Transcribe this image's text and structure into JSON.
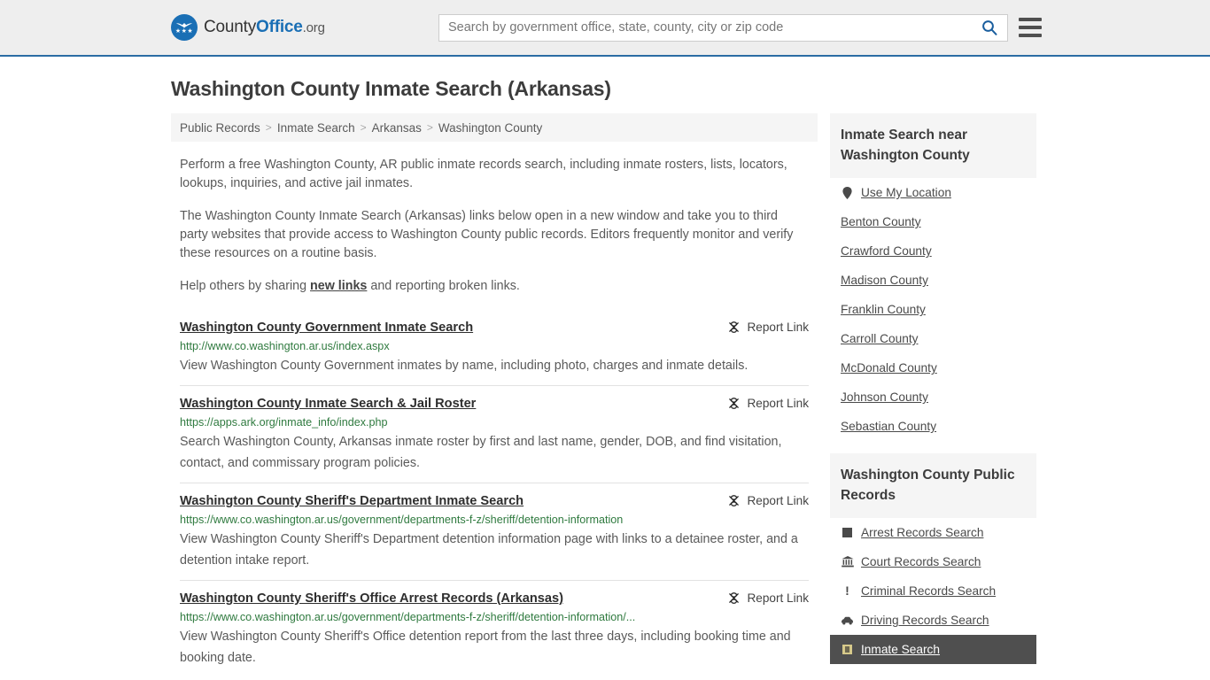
{
  "header": {
    "logo": {
      "part1": "County",
      "part2": "Office",
      "part3": ".org",
      "icon": "eagle-shield-icon"
    },
    "search": {
      "placeholder": "Search by government office, state, county, city or zip code",
      "value": "",
      "icon": "search-icon"
    },
    "menu": {
      "icon": "hamburger-menu-icon",
      "label": "Menu"
    }
  },
  "page": {
    "title": "Washington County Inmate Search (Arkansas)"
  },
  "breadcrumb": {
    "separator": ">",
    "items": [
      {
        "label": "Public Records"
      },
      {
        "label": "Inmate Search"
      },
      {
        "label": "Arkansas"
      },
      {
        "label": "Washington County"
      }
    ]
  },
  "intro": {
    "p1": "Perform a free Washington County, AR public inmate records search, including inmate rosters, lists, locators, lookups, inquiries, and active jail inmates.",
    "p2": "The Washington County Inmate Search (Arkansas) links below open in a new window and take you to third party websites that provide access to Washington County public records. Editors frequently monitor and verify these resources on a routine basis.",
    "p3_before": "Help others by sharing ",
    "p3_link": "new links",
    "p3_after": " and reporting broken links."
  },
  "report_link": {
    "label": "Report Link",
    "icon": "broken-link-icon"
  },
  "results": [
    {
      "title": "Washington County Government Inmate Search",
      "url": "http://www.co.washington.ar.us/index.aspx",
      "description": "View Washington County Government inmates by name, including photo, charges and inmate details."
    },
    {
      "title": "Washington County Inmate Search & Jail Roster",
      "url": "https://apps.ark.org/inmate_info/index.php",
      "description": "Search Washington County, Arkansas inmate roster by first and last name, gender, DOB, and find visitation, contact, and commissary program policies."
    },
    {
      "title": "Washington County Sheriff's Department Inmate Search",
      "url": "https://www.co.washington.ar.us/government/departments-f-z/sheriff/detention-information",
      "description": "View Washington County Sheriff's Department detention information page with links to a detainee roster, and a detention intake report."
    },
    {
      "title": "Washington County Sheriff's Office Arrest Records (Arkansas)",
      "url": "https://www.co.washington.ar.us/government/departments-f-z/sheriff/detention-information/...",
      "description": "View Washington County Sheriff's Office detention report from the last three days, including booking time and booking date."
    }
  ],
  "sidebar": {
    "nearby": {
      "heading": "Inmate Search near Washington County",
      "items": [
        {
          "label": "Use My Location",
          "icon": "map-pin-icon"
        },
        {
          "label": "Benton County",
          "icon": "none"
        },
        {
          "label": "Crawford County",
          "icon": "none"
        },
        {
          "label": "Madison County",
          "icon": "none"
        },
        {
          "label": "Franklin County",
          "icon": "none"
        },
        {
          "label": "Carroll County",
          "icon": "none"
        },
        {
          "label": "McDonald County",
          "icon": "none"
        },
        {
          "label": "Johnson County",
          "icon": "none"
        },
        {
          "label": "Sebastian County",
          "icon": "none"
        }
      ]
    },
    "public_records": {
      "heading": "Washington County Public Records",
      "items": [
        {
          "label": "Arrest Records Search",
          "icon": "fingerprint-square-icon",
          "active": false
        },
        {
          "label": "Court Records Search",
          "icon": "courthouse-icon",
          "active": false
        },
        {
          "label": "Criminal Records Search",
          "icon": "exclamation-icon",
          "active": false
        },
        {
          "label": "Driving Records Search",
          "icon": "car-icon",
          "active": false
        },
        {
          "label": "Inmate Search",
          "icon": "inmate-badge-icon",
          "active": true
        }
      ]
    }
  },
  "colors": {
    "header_bg": "#eeeeee",
    "header_border": "#2b6ca3",
    "brand_blue": "#1a6fb5",
    "url_green": "#2f7a3f",
    "panel_gray": "#f5f5f5",
    "active_dark": "#4f4f4f"
  }
}
